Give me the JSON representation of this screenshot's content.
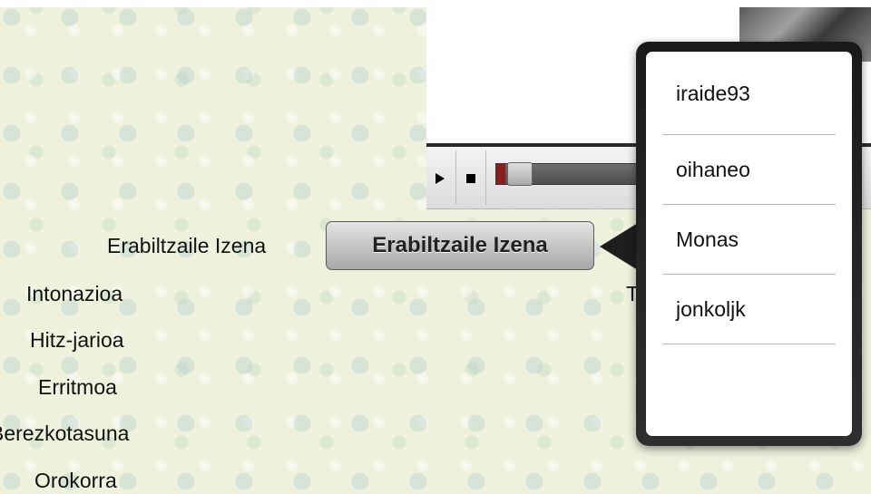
{
  "form": {
    "labels": [
      "Erabiltzaile Izena",
      "Intonazioa",
      "Hitz-jarioa",
      "Erritmoa",
      "Berezkotasuna",
      "Orokorra"
    ],
    "user_button_label": "Erabiltzaile Izena",
    "partial_text": "T"
  },
  "popover": {
    "items": [
      "iraide93",
      "oihaneo",
      "Monas",
      "jonkoljk"
    ]
  }
}
